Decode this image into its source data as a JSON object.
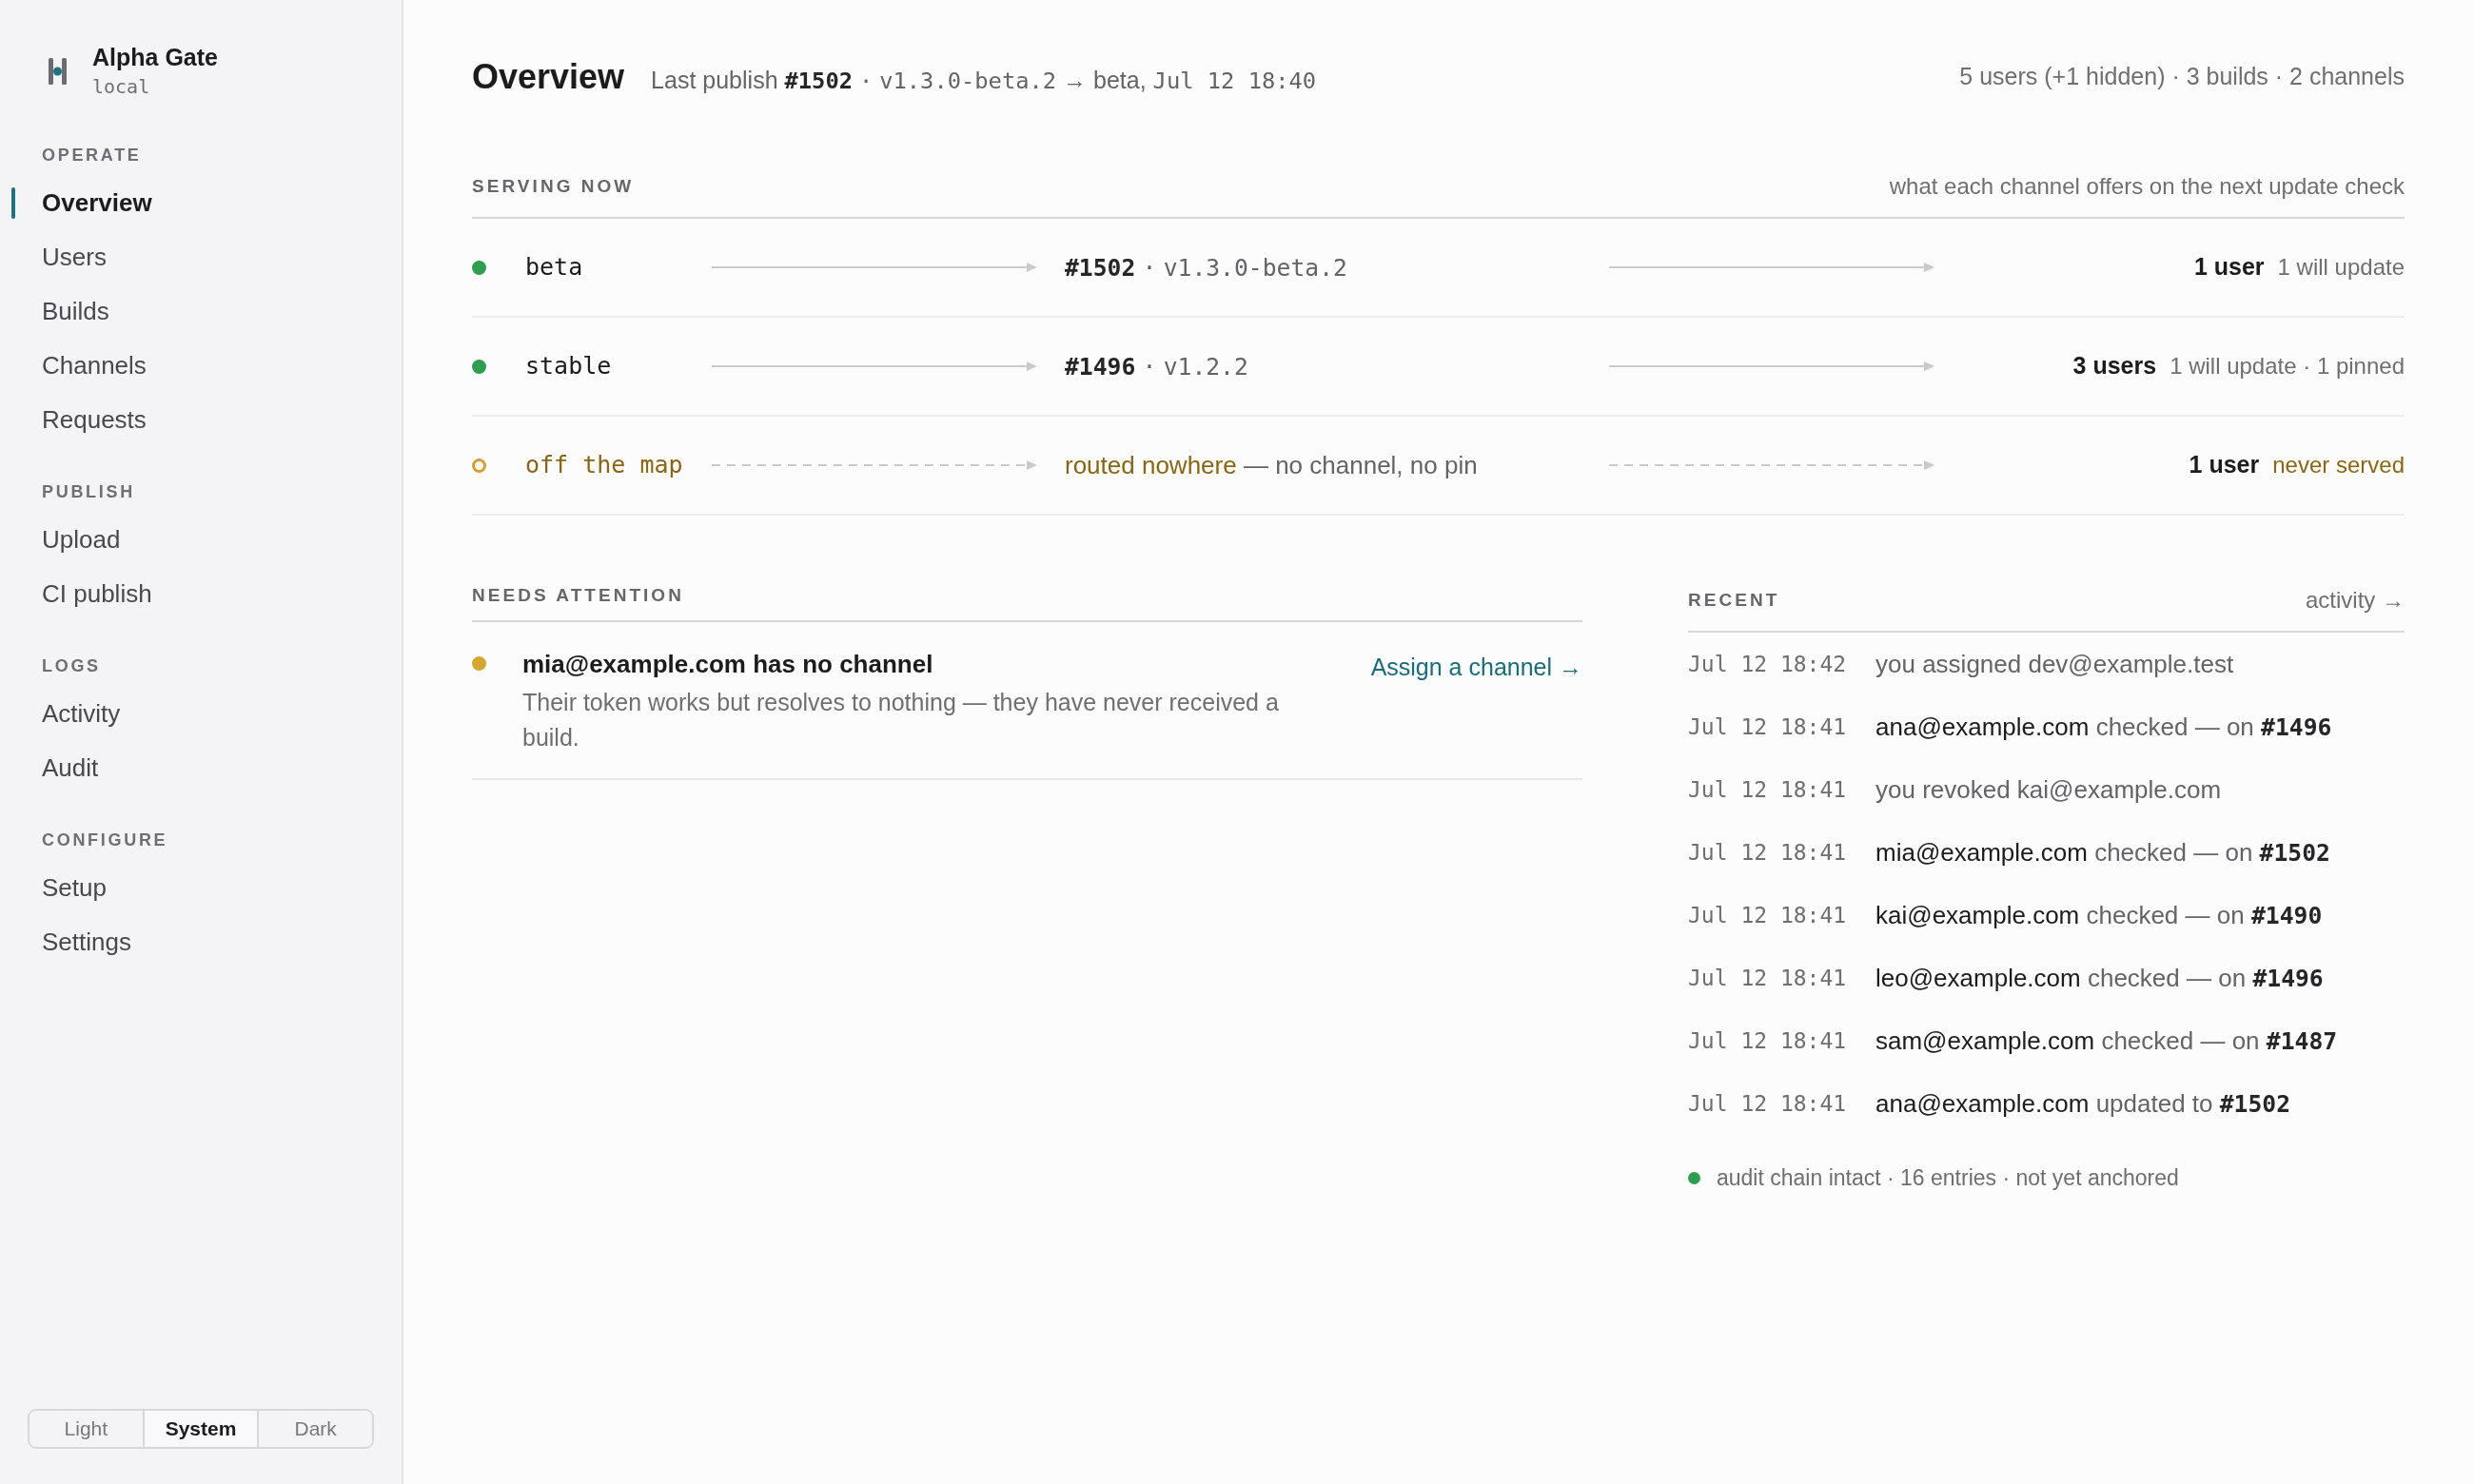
{
  "sidebar": {
    "brand": {
      "title": "Alpha Gate",
      "subtitle": "local"
    },
    "sections": [
      {
        "label": "OPERATE",
        "items": [
          {
            "label": "Overview",
            "selected": true
          },
          {
            "label": "Users",
            "selected": false
          },
          {
            "label": "Builds",
            "selected": false
          },
          {
            "label": "Channels",
            "selected": false
          },
          {
            "label": "Requests",
            "selected": false
          }
        ]
      },
      {
        "label": "PUBLISH",
        "items": [
          {
            "label": "Upload",
            "selected": false
          },
          {
            "label": "CI publish",
            "selected": false
          }
        ]
      },
      {
        "label": "LOGS",
        "items": [
          {
            "label": "Activity",
            "selected": false
          },
          {
            "label": "Audit",
            "selected": false
          }
        ]
      },
      {
        "label": "CONFIGURE",
        "items": [
          {
            "label": "Setup",
            "selected": false
          },
          {
            "label": "Settings",
            "selected": false
          }
        ]
      }
    ],
    "theme_options": [
      {
        "label": "Light",
        "selected": false
      },
      {
        "label": "System",
        "selected": true
      },
      {
        "label": "Dark",
        "selected": false
      }
    ]
  },
  "header": {
    "title": "Overview",
    "last_publish": [
      {
        "kind": "text",
        "text": "Last publish"
      },
      {
        "kind": "build",
        "text": "#1502"
      },
      {
        "kind": "mono",
        "text": "·"
      },
      {
        "kind": "mono",
        "text": "v1.3.0-beta.2"
      },
      {
        "kind": "text",
        "text": "→ beta,"
      },
      {
        "kind": "mono",
        "text": "Jul 12 18:40"
      }
    ],
    "summary": "5 users (+1 hidden) · 3 builds · 2 channels"
  },
  "serving": {
    "label": "SERVING NOW",
    "hint": "what each channel offers on the next update check",
    "channels": [
      {
        "kind": "routed",
        "name": "beta",
        "color": "#2e9e4f",
        "target": [
          {
            "kind": "build",
            "text": "#1502"
          },
          {
            "kind": "mono",
            "text": "·"
          },
          {
            "kind": "mono",
            "text": "v1.3.0-beta.2"
          }
        ],
        "users": "1 user",
        "note": "1 will update"
      },
      {
        "kind": "routed",
        "name": "stable",
        "color": "#2e9e4f",
        "target": [
          {
            "kind": "build",
            "text": "#1496"
          },
          {
            "kind": "mono",
            "text": "·"
          },
          {
            "kind": "mono",
            "text": "v1.2.2"
          }
        ],
        "users": "3 users",
        "note": "1 will update · 1 pinned"
      },
      {
        "kind": "unrouted",
        "name": "off the map",
        "color": "#d6a12c",
        "target": [
          {
            "kind": "warn",
            "text": "routed nowhere"
          },
          {
            "kind": "text",
            "text": "— no channel, no pin"
          }
        ],
        "users": "1 user",
        "note": "never served"
      }
    ]
  },
  "attention": {
    "label": "NEEDS ATTENTION",
    "items": [
      {
        "title": "mia@example.com has no channel",
        "description": "Their token works but resolves to nothing — they have never received a build.",
        "action": "Assign a channel →"
      }
    ]
  },
  "recent": {
    "label": "RECENT",
    "link": "activity →",
    "entries": [
      {
        "time": "Jul 12 18:42",
        "text": [
          {
            "kind": "text",
            "text": "you assigned dev@example.test"
          }
        ]
      },
      {
        "time": "Jul 12 18:41",
        "text": [
          {
            "kind": "subject",
            "text": "ana@example.com"
          },
          {
            "kind": "text",
            "text": "checked — on"
          },
          {
            "kind": "build",
            "text": "#1496"
          }
        ]
      },
      {
        "time": "Jul 12 18:41",
        "text": [
          {
            "kind": "text",
            "text": "you revoked kai@example.com"
          }
        ]
      },
      {
        "time": "Jul 12 18:41",
        "text": [
          {
            "kind": "subject",
            "text": "mia@example.com"
          },
          {
            "kind": "text",
            "text": "checked — on"
          },
          {
            "kind": "build",
            "text": "#1502"
          }
        ]
      },
      {
        "time": "Jul 12 18:41",
        "text": [
          {
            "kind": "subject",
            "text": "kai@example.com"
          },
          {
            "kind": "text",
            "text": "checked — on"
          },
          {
            "kind": "build",
            "text": "#1490"
          }
        ]
      },
      {
        "time": "Jul 12 18:41",
        "text": [
          {
            "kind": "subject",
            "text": "leo@example.com"
          },
          {
            "kind": "text",
            "text": "checked — on"
          },
          {
            "kind": "build",
            "text": "#1496"
          }
        ]
      },
      {
        "time": "Jul 12 18:41",
        "text": [
          {
            "kind": "subject",
            "text": "sam@example.com"
          },
          {
            "kind": "text",
            "text": "checked — on"
          },
          {
            "kind": "build",
            "text": "#1487"
          }
        ]
      },
      {
        "time": "Jul 12 18:41",
        "text": [
          {
            "kind": "subject",
            "text": "ana@example.com"
          },
          {
            "kind": "text",
            "text": "updated to"
          },
          {
            "kind": "build",
            "text": "#1502"
          }
        ]
      }
    ],
    "footer": "audit chain intact · 16 entries · not yet anchored"
  }
}
